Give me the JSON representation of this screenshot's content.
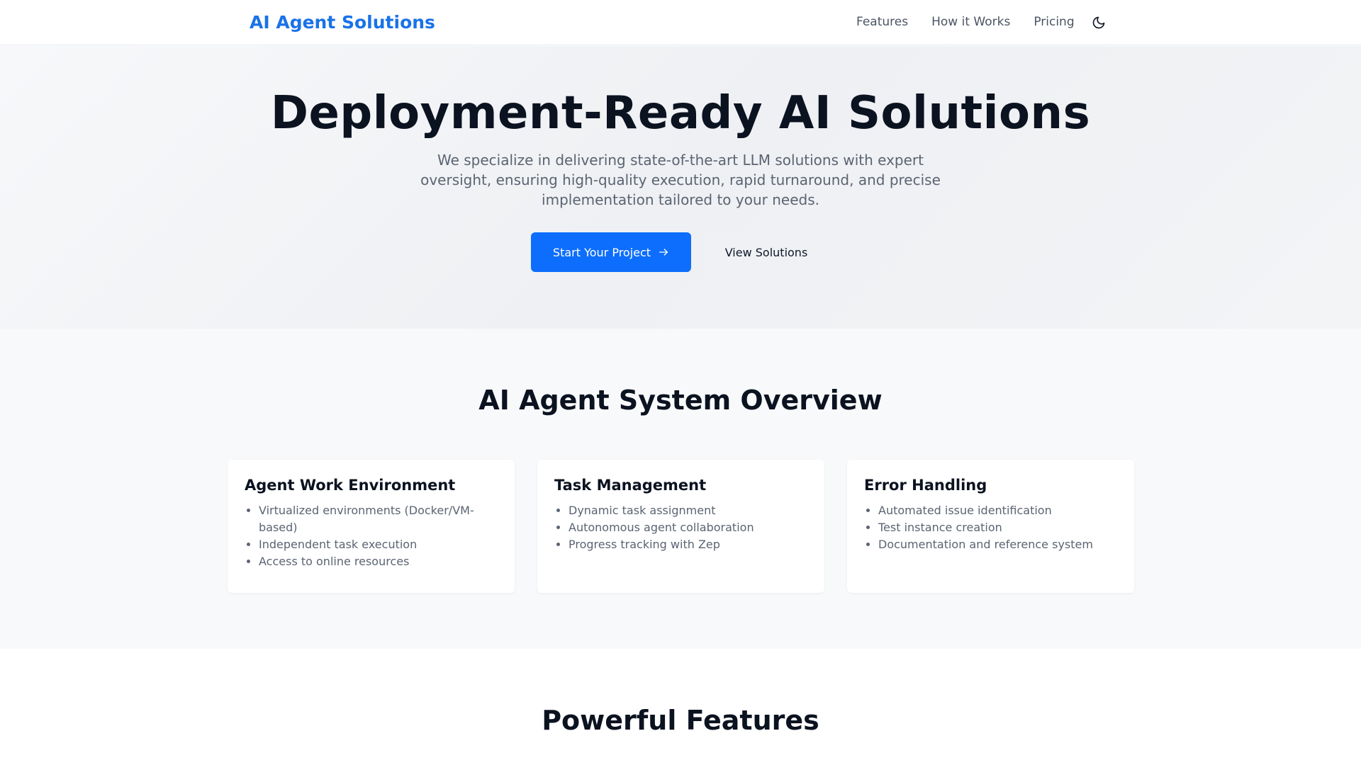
{
  "header": {
    "brand": "AI Agent Solutions",
    "nav": [
      "Features",
      "How it Works",
      "Pricing"
    ],
    "theme_icon": "moon-icon"
  },
  "hero": {
    "title": "Deployment-Ready AI Solutions",
    "subtitle": "We specialize in delivering state-of-the-art LLM solutions with expert oversight, ensuring high-quality execution, rapid turnaround, and precise implementation tailored to your needs.",
    "primary_button": "Start Your Project",
    "primary_button_icon": "arrow-right-icon",
    "secondary_button": "View Solutions"
  },
  "overview": {
    "title": "AI Agent System Overview",
    "cards": [
      {
        "title": "Agent Work Environment",
        "items": [
          "Virtualized environments (Docker/VM-based)",
          "Independent task execution",
          "Access to online resources"
        ]
      },
      {
        "title": "Task Management",
        "items": [
          "Dynamic task assignment",
          "Autonomous agent collaboration",
          "Progress tracking with Zep"
        ]
      },
      {
        "title": "Error Handling",
        "items": [
          "Automated issue identification",
          "Test instance creation",
          "Documentation and reference system"
        ]
      }
    ]
  },
  "features": {
    "title": "Powerful Features"
  },
  "colors": {
    "brand": "#1a73e8",
    "primary_button": "#0d6efd"
  }
}
